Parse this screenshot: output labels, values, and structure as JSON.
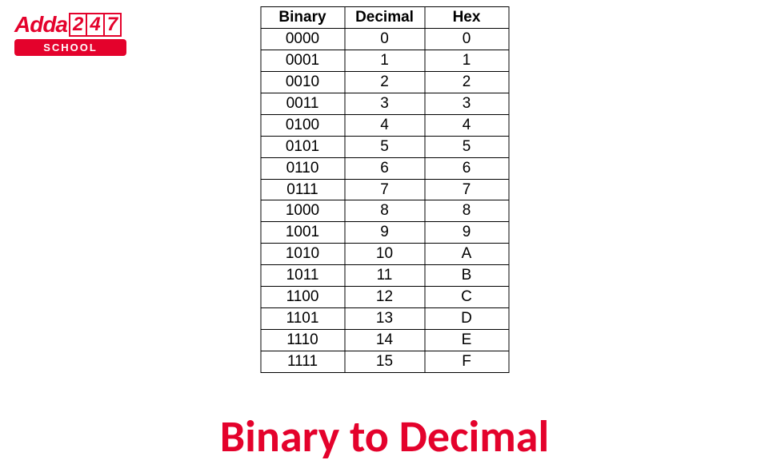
{
  "logo": {
    "brand": "Adda",
    "d1": "2",
    "d2": "4",
    "d3": "7",
    "sub": "SCHOOL"
  },
  "table": {
    "headers": {
      "binary": "Binary",
      "decimal": "Decimal",
      "hex": "Hex"
    },
    "rows": [
      {
        "binary": "0000",
        "decimal": "0",
        "hex": "0"
      },
      {
        "binary": "0001",
        "decimal": "1",
        "hex": "1"
      },
      {
        "binary": "0010",
        "decimal": "2",
        "hex": "2"
      },
      {
        "binary": "0011",
        "decimal": "3",
        "hex": "3"
      },
      {
        "binary": "0100",
        "decimal": "4",
        "hex": "4"
      },
      {
        "binary": "0101",
        "decimal": "5",
        "hex": "5"
      },
      {
        "binary": "0110",
        "decimal": "6",
        "hex": "6"
      },
      {
        "binary": "0111",
        "decimal": "7",
        "hex": "7"
      },
      {
        "binary": "1000",
        "decimal": "8",
        "hex": "8"
      },
      {
        "binary": "1001",
        "decimal": "9",
        "hex": "9"
      },
      {
        "binary": "1010",
        "decimal": "10",
        "hex": "A"
      },
      {
        "binary": "1011",
        "decimal": "11",
        "hex": "B"
      },
      {
        "binary": "1100",
        "decimal": "12",
        "hex": "C"
      },
      {
        "binary": "1101",
        "decimal": "13",
        "hex": "D"
      },
      {
        "binary": "1110",
        "decimal": "14",
        "hex": "E"
      },
      {
        "binary": "1111",
        "decimal": "15",
        "hex": "F"
      }
    ]
  },
  "title": "Binary to Decimal",
  "chart_data": {
    "type": "table",
    "title": "Binary to Decimal",
    "columns": [
      "Binary",
      "Decimal",
      "Hex"
    ],
    "rows": [
      [
        "0000",
        0,
        "0"
      ],
      [
        "0001",
        1,
        "1"
      ],
      [
        "0010",
        2,
        "2"
      ],
      [
        "0011",
        3,
        "3"
      ],
      [
        "0100",
        4,
        "4"
      ],
      [
        "0101",
        5,
        "5"
      ],
      [
        "0110",
        6,
        "6"
      ],
      [
        "0111",
        7,
        "7"
      ],
      [
        "1000",
        8,
        "8"
      ],
      [
        "1001",
        9,
        "9"
      ],
      [
        "1010",
        10,
        "A"
      ],
      [
        "1011",
        11,
        "B"
      ],
      [
        "1100",
        12,
        "C"
      ],
      [
        "1101",
        13,
        "D"
      ],
      [
        "1110",
        14,
        "E"
      ],
      [
        "1111",
        15,
        "F"
      ]
    ]
  }
}
